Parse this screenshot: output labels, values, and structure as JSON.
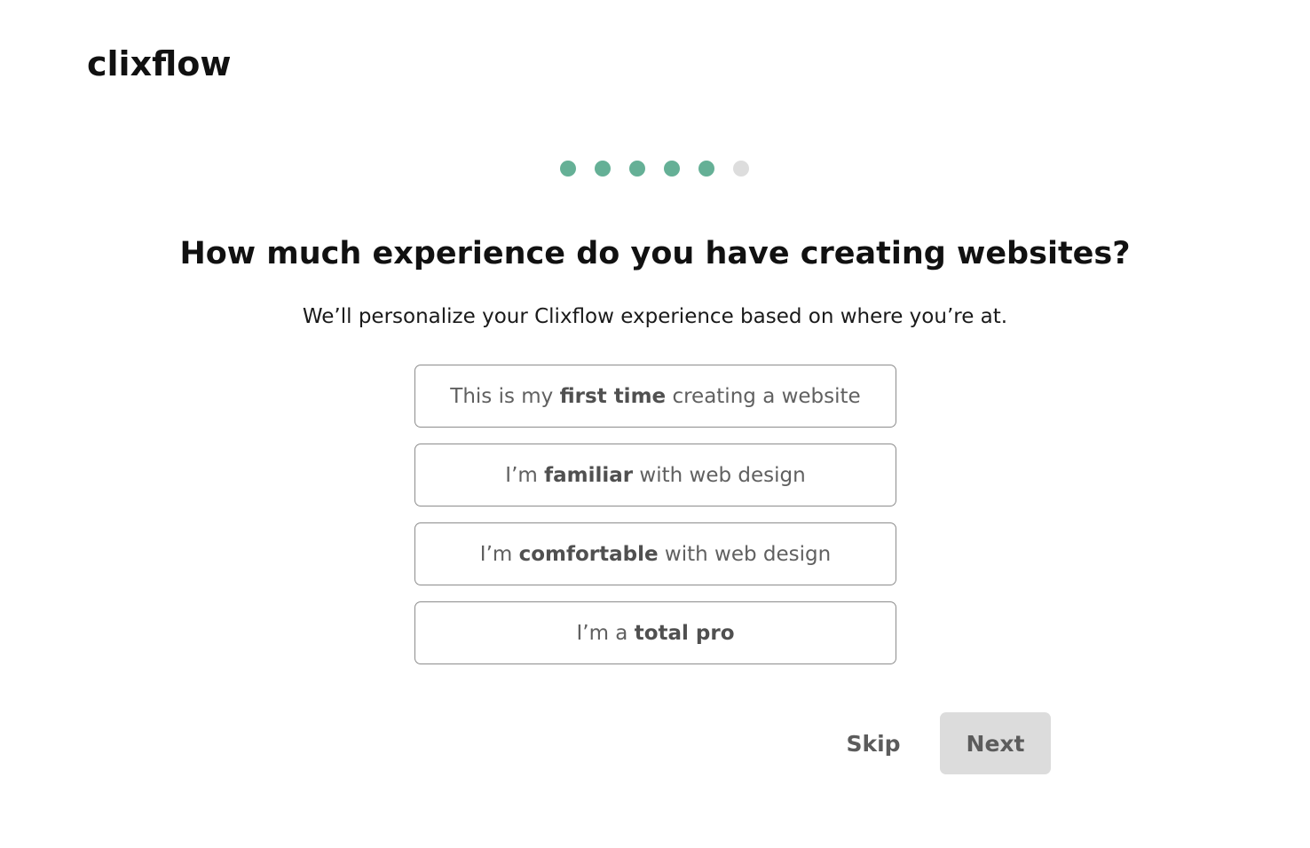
{
  "brand": {
    "logo_text": "clixflow",
    "accent_color": "#65b096",
    "inactive_color": "#dddddd"
  },
  "progress": {
    "total_steps": 6,
    "completed_steps": 5
  },
  "question": {
    "title": "How much experience do you have creating websites?",
    "subtitle": "We’ll personalize your Clixflow experience based on where you’re at."
  },
  "options": [
    {
      "pre": "This is my ",
      "bold": "first time",
      "post": " creating a website"
    },
    {
      "pre": "I’m ",
      "bold": "familiar",
      "post": " with web design"
    },
    {
      "pre": "I’m ",
      "bold": "comfortable",
      "post": " with web design"
    },
    {
      "pre": "I’m a ",
      "bold": "total pro",
      "post": ""
    }
  ],
  "actions": {
    "skip_label": "Skip",
    "next_label": "Next"
  }
}
